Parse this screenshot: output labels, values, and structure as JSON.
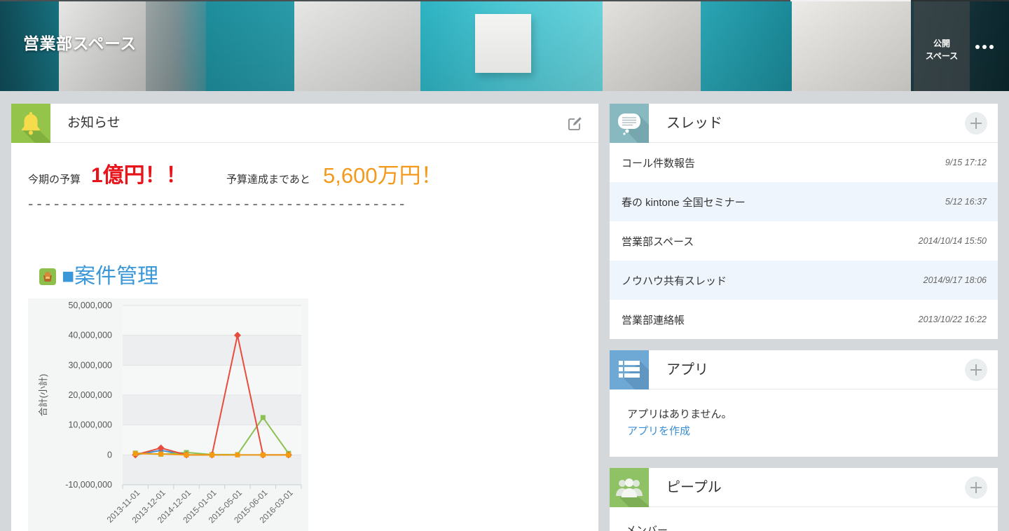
{
  "header": {
    "title": "営業部スペース",
    "public_badge_line1": "公開",
    "public_badge_line2": "スペース",
    "menu_icon": "more-horizontal-icon"
  },
  "notice": {
    "icon": "bell-icon",
    "title": "お知らせ",
    "edit_icon": "edit-icon",
    "budget_label": "今期の予算",
    "budget_value": "1億円！！",
    "remaining_label": "予算達成まであと",
    "remaining_value": "5,600万円！",
    "divider": "--------------------------------------------",
    "section_icon": "app-icon",
    "section_title": "■案件管理",
    "colors": {
      "budget_value": "#e8141c",
      "remaining_value": "#f39a1c",
      "section_title": "#3a97d8"
    }
  },
  "chart_data": {
    "type": "line",
    "ylabel": "合計(小計)",
    "categories": [
      "2013-11-01",
      "2013-12-01",
      "2014-12-01",
      "2015-01-01",
      "2015-05-01",
      "2015-06-01",
      "2016-03-01"
    ],
    "ylim": [
      -10000000,
      50000000
    ],
    "yticks": [
      50000000,
      40000000,
      30000000,
      20000000,
      10000000,
      0,
      -10000000
    ],
    "ytick_labels": [
      "50,000,000",
      "40,000,000",
      "30,000,000",
      "20,000,000",
      "10,000,000",
      "0",
      "-10,000,000"
    ],
    "grid": true,
    "legend": "none",
    "series": [
      {
        "color": "#3b8fd2",
        "marker": "circle",
        "values": [
          0,
          1500000,
          0,
          0,
          0,
          0,
          0
        ]
      },
      {
        "color": "#8cc152",
        "marker": "square",
        "values": [
          600000,
          200000,
          800000,
          100000,
          100000,
          12500000,
          500000
        ]
      },
      {
        "color": "#e74c3c",
        "marker": "diamond",
        "values": [
          0,
          2300000,
          0,
          0,
          40000000,
          0,
          0
        ]
      },
      {
        "color": "#f39c12",
        "marker": "square",
        "values": [
          400000,
          300000,
          0,
          0,
          0,
          0,
          0
        ]
      }
    ]
  },
  "threads": {
    "icon": "thread-icon",
    "title": "スレッド",
    "add_icon": "plus-icon",
    "items": [
      {
        "title": "コール件数報告",
        "date": "9/15 17:12"
      },
      {
        "title": "春の kintone 全国セミナー",
        "date": "5/12 16:37"
      },
      {
        "title": "営業部スペース",
        "date": "2014/10/14 15:50"
      },
      {
        "title": "ノウハウ共有スレッド",
        "date": "2014/9/17 18:06"
      },
      {
        "title": "営業部連絡帳",
        "date": "2013/10/22 16:22"
      }
    ]
  },
  "apps": {
    "icon": "app-list-icon",
    "title": "アプリ",
    "add_icon": "plus-icon",
    "empty_text": "アプリはありません。",
    "create_link": "アプリを作成"
  },
  "people": {
    "icon": "people-icon",
    "title": "ピープル",
    "add_icon": "plus-icon",
    "members_label": "メンバー"
  }
}
